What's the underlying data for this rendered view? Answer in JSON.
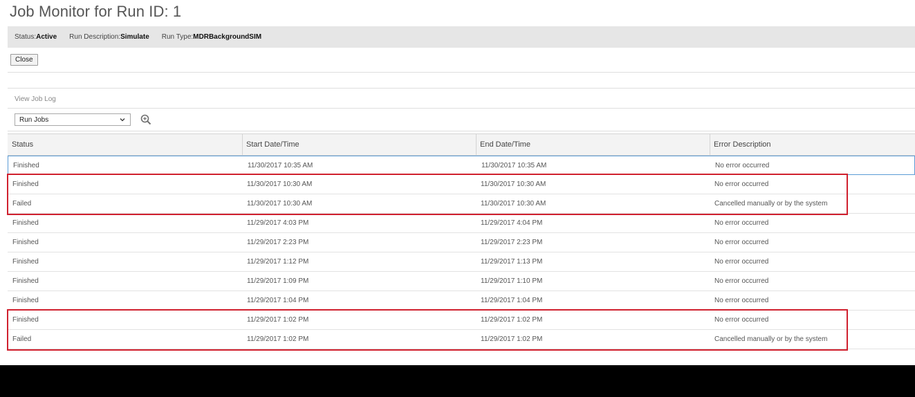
{
  "page": {
    "title": "Job Monitor for Run ID: 1"
  },
  "status_bar": {
    "status_label": "Status:",
    "status_value": "Active",
    "description_label": "Run Description:",
    "description_value": "Simulate",
    "type_label": "Run Type:",
    "type_value": "MDRBackgroundSIM"
  },
  "toolbar": {
    "close_label": "Close"
  },
  "job_log": {
    "view_label": "View Job Log",
    "selected_option": "Run Jobs",
    "chevron_icon": "chevron-down-icon",
    "search_icon": "zoom-search-icon"
  },
  "table": {
    "columns": [
      "Status",
      "Start Date/Time",
      "End Date/Time",
      "Error Description"
    ],
    "rows": [
      {
        "status": "Finished",
        "start": "11/30/2017 10:35 AM",
        "end": "11/30/2017 10:35 AM",
        "error": "No error occurred"
      },
      {
        "status": "Finished",
        "start": "11/30/2017 10:30 AM",
        "end": "11/30/2017 10:30 AM",
        "error": "No error occurred"
      },
      {
        "status": "Failed",
        "start": "11/30/2017 10:30 AM",
        "end": "11/30/2017 10:30 AM",
        "error": "Cancelled manually or by the system"
      },
      {
        "status": "Finished",
        "start": "11/29/2017 4:03 PM",
        "end": "11/29/2017 4:04 PM",
        "error": "No error occurred"
      },
      {
        "status": "Finished",
        "start": "11/29/2017 2:23 PM",
        "end": "11/29/2017 2:23 PM",
        "error": "No error occurred"
      },
      {
        "status": "Finished",
        "start": "11/29/2017 1:12 PM",
        "end": "11/29/2017 1:13 PM",
        "error": "No error occurred"
      },
      {
        "status": "Finished",
        "start": "11/29/2017 1:09 PM",
        "end": "11/29/2017 1:10 PM",
        "error": "No error occurred"
      },
      {
        "status": "Finished",
        "start": "11/29/2017 1:04 PM",
        "end": "11/29/2017 1:04 PM",
        "error": "No error occurred"
      },
      {
        "status": "Finished",
        "start": "11/29/2017 1:02 PM",
        "end": "11/29/2017 1:02 PM",
        "error": "No error occurred"
      },
      {
        "status": "Failed",
        "start": "11/29/2017 1:02 PM",
        "end": "11/29/2017 1:02 PM",
        "error": "Cancelled manually or by the system"
      }
    ]
  },
  "colors": {
    "highlight": "#d0202e",
    "selection": "#5b9bd5"
  }
}
